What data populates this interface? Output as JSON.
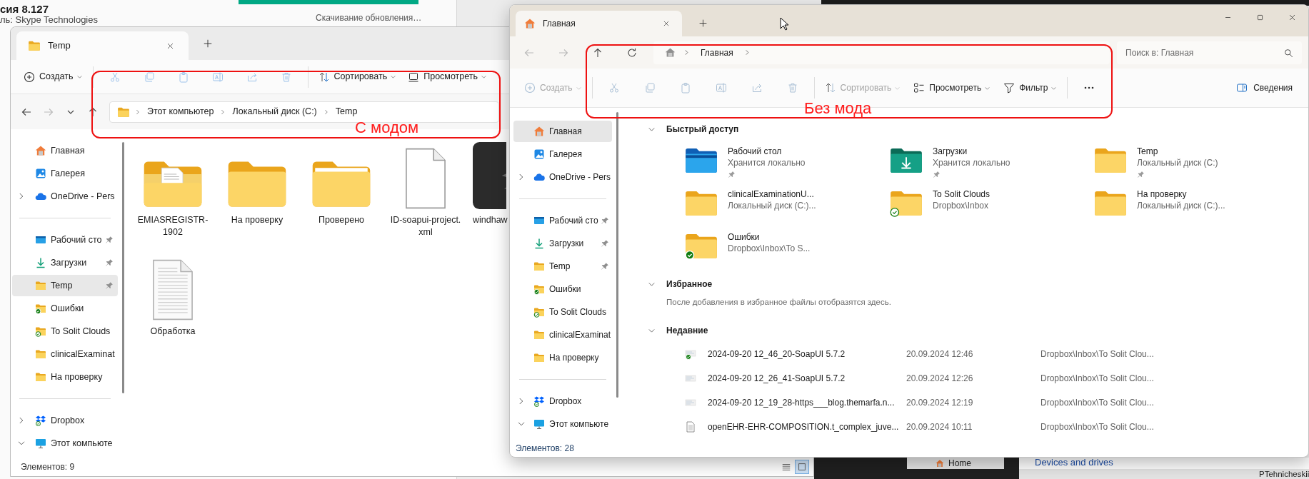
{
  "background": {
    "app_version": "сия 8.127",
    "publisher": "ль: Skype Technologies",
    "update_status": "Скачивание обновления…",
    "tab": "Home",
    "section_heading": "Devices and drives",
    "user_name": "PTehnicheskii"
  },
  "left_window": {
    "tabs": [
      {
        "title": "Temp",
        "selected": true
      }
    ],
    "toolbar": [
      {
        "buttons": [
          {
            "kind": "create",
            "label": "Создать",
            "dropdown": true,
            "disabled": false
          }
        ]
      },
      {
        "buttons": [
          {
            "kind": "cut",
            "disabled": true
          },
          {
            "kind": "copy",
            "disabled": true
          },
          {
            "kind": "paste",
            "disabled": true
          },
          {
            "kind": "rename",
            "disabled": true
          },
          {
            "kind": "share",
            "disabled": true
          },
          {
            "kind": "delete",
            "disabled": true
          }
        ]
      },
      {
        "buttons": [
          {
            "kind": "sort",
            "label": "Сортировать",
            "dropdown": true,
            "disabled": false
          },
          {
            "kind": "view",
            "label": "Просмотреть",
            "dropdown": true,
            "disabled": false
          }
        ]
      }
    ],
    "nav_buttons": [
      {
        "kind": "back",
        "disabled": false
      },
      {
        "kind": "forward",
        "disabled": true
      },
      {
        "kind": "recent",
        "disabled": false
      },
      {
        "kind": "up",
        "disabled": false
      }
    ],
    "breadcrumb": [
      "Этот компьютер",
      "Локальный диск (C:)",
      "Temp"
    ],
    "sidebar": [
      {
        "items": [
          {
            "kind": "home",
            "label": "Главная",
            "selected": false,
            "pinned": false
          },
          {
            "kind": "gallery",
            "label": "Галерея",
            "selected": false,
            "pinned": false
          },
          {
            "kind": "cloud",
            "label": "OneDrive - Pers",
            "selected": false,
            "pinned": false,
            "expanded": false
          }
        ]
      },
      {
        "items": [
          {
            "kind": "desktop",
            "label": "Рабочий сто",
            "selected": false,
            "pinned": true
          },
          {
            "kind": "download",
            "label": "Загрузки",
            "selected": false,
            "pinned": true
          },
          {
            "kind": "folder",
            "label": "Temp",
            "selected": true,
            "pinned": true
          },
          {
            "kind": "folder_kept",
            "label": "Ошибки",
            "selected": false,
            "pinned": false
          },
          {
            "kind": "folder_synced",
            "label": "To Solit Clouds",
            "selected": false,
            "pinned": false
          },
          {
            "kind": "folder",
            "label": "clinicalExaminat",
            "selected": false,
            "pinned": false
          },
          {
            "kind": "folder",
            "label": "На проверку",
            "selected": false,
            "pinned": false
          }
        ]
      },
      {
        "items": [
          {
            "kind": "dropbox",
            "label": "Dropbox",
            "selected": false,
            "pinned": false,
            "expanded": false
          },
          {
            "kind": "computer",
            "label": "Этот компьюте",
            "selected": false,
            "pinned": false,
            "expanded": true
          }
        ]
      }
    ],
    "files": [
      {
        "kind": "folder_doc",
        "name": "EMIASREGISTR-1902"
      },
      {
        "kind": "folder",
        "name": "На проверку"
      },
      {
        "kind": "folder_sheet",
        "name": "Проверено"
      },
      {
        "kind": "file",
        "name": "ID-soapui-project.xml"
      },
      {
        "kind": "app",
        "name": "windhaw"
      },
      {
        "kind": "document",
        "name": "Обработка"
      }
    ],
    "status": "Элементов: 9",
    "view_modes": [
      {
        "kind": "details",
        "selected": false
      },
      {
        "kind": "tiles",
        "selected": true
      }
    ]
  },
  "right_window": {
    "tabs": [
      {
        "title": "Главная",
        "selected": true
      }
    ],
    "nav_buttons": [
      {
        "kind": "back",
        "disabled": true
      },
      {
        "kind": "forward",
        "disabled": true
      },
      {
        "kind": "up",
        "disabled": false
      },
      {
        "kind": "refresh",
        "disabled": false
      }
    ],
    "breadcrumb": [
      "Главная"
    ],
    "search": {
      "placeholder": "Поиск в: Главная"
    },
    "toolbar": [
      {
        "buttons": [
          {
            "kind": "create",
            "label": "Создать",
            "dropdown": true,
            "disabled": true
          }
        ]
      },
      {
        "buttons": [
          {
            "kind": "cut",
            "disabled": true
          },
          {
            "kind": "copy",
            "disabled": true
          },
          {
            "kind": "paste",
            "disabled": true
          },
          {
            "kind": "rename",
            "disabled": true
          },
          {
            "kind": "share",
            "disabled": true
          },
          {
            "kind": "delete",
            "disabled": true
          }
        ]
      },
      {
        "buttons": [
          {
            "kind": "sort",
            "label": "Сортировать",
            "dropdown": true,
            "disabled": true
          },
          {
            "kind": "layout",
            "label": "Просмотреть",
            "dropdown": true,
            "disabled": false
          },
          {
            "kind": "filter",
            "label": "Фильтр",
            "dropdown": true,
            "disabled": false
          }
        ]
      },
      {
        "buttons": [
          {
            "kind": "more",
            "disabled": false
          }
        ]
      }
    ],
    "details_button": {
      "label": "Сведения"
    },
    "sidebar": [
      {
        "items": [
          {
            "kind": "home",
            "label": "Главная",
            "selected": true,
            "pinned": false
          },
          {
            "kind": "gallery",
            "label": "Галерея",
            "selected": false,
            "pinned": false
          },
          {
            "kind": "cloud",
            "label": "OneDrive - Pers",
            "selected": false,
            "pinned": false,
            "expanded": false
          }
        ]
      },
      {
        "items": [
          {
            "kind": "desktop",
            "label": "Рабочий сто",
            "selected": false,
            "pinned": true
          },
          {
            "kind": "download",
            "label": "Загрузки",
            "selected": false,
            "pinned": true
          },
          {
            "kind": "folder",
            "label": "Temp",
            "selected": false,
            "pinned": true
          },
          {
            "kind": "folder_kept",
            "label": "Ошибки",
            "selected": false,
            "pinned": false
          },
          {
            "kind": "folder_synced",
            "label": "To Solit Clouds",
            "selected": false,
            "pinned": false
          },
          {
            "kind": "folder",
            "label": "clinicalExaminat",
            "selected": false,
            "pinned": false
          },
          {
            "kind": "folder",
            "label": "На проверку",
            "selected": false,
            "pinned": false
          }
        ]
      },
      {
        "items": [
          {
            "kind": "dropbox",
            "label": "Dropbox",
            "selected": false,
            "pinned": false,
            "expanded": false
          },
          {
            "kind": "computer",
            "label": "Этот компьюте",
            "selected": false,
            "pinned": false,
            "expanded": true
          }
        ]
      }
    ],
    "quick_access": {
      "title": "Быстрый доступ",
      "expanded": true,
      "items": [
        {
          "kind": "desktop",
          "name": "Рабочий стол",
          "location": "Хранится локально",
          "pinned": true
        },
        {
          "kind": "downloads",
          "name": "Загрузки",
          "location": "Хранится локально",
          "pinned": true
        },
        {
          "kind": "folder",
          "name": "Temp",
          "location": "Локальный диск (C:)",
          "pinned": true
        },
        {
          "kind": "folder",
          "name": "clinicalExaminationU...",
          "location": "Локальный диск (C:)...",
          "pinned": false
        },
        {
          "kind": "folder",
          "name": "To Solit Clouds",
          "location": "Dropbox\\Inbox",
          "pinned": false,
          "available_offline": true
        },
        {
          "kind": "folder",
          "name": "На проверку",
          "location": "Локальный диск (C:)...",
          "pinned": false
        },
        {
          "kind": "folder",
          "name": "Ошибки",
          "location": "Dropbox\\Inbox\\To S...",
          "pinned": false,
          "always_kept": true
        }
      ]
    },
    "favorites": {
      "title": "Избранное",
      "expanded": true,
      "message": "После добавления в избранное файлы отобразятся здесь."
    },
    "recent": {
      "title": "Недавние",
      "expanded": true,
      "items": [
        {
          "kind": "image",
          "name": "2024-09-20 12_46_20-SoapUI 5.7.2",
          "date": "20.09.2024 12:46",
          "location": "Dropbox\\Inbox\\To Solit Clou...",
          "always_kept": true
        },
        {
          "kind": "image",
          "name": "2024-09-20 12_26_41-SoapUI 5.7.2",
          "date": "20.09.2024 12:26",
          "location": "Dropbox\\Inbox\\To Solit Clou..."
        },
        {
          "kind": "image",
          "name": "2024-09-20 12_19_28-https___blog.themarfa.n...",
          "date": "20.09.2024 12:19",
          "location": "Dropbox\\Inbox\\To Solit Clou..."
        },
        {
          "kind": "document",
          "name": "openEHR-EHR-COMPOSITION.t_complex_juve...",
          "date": "20.09.2024 10:11",
          "location": "Dropbox\\Inbox\\To Solit Clou..."
        }
      ]
    },
    "status": "Элементов: 28"
  },
  "annotations": [
    {
      "label": "С модом"
    },
    {
      "label": "Без мода"
    }
  ]
}
